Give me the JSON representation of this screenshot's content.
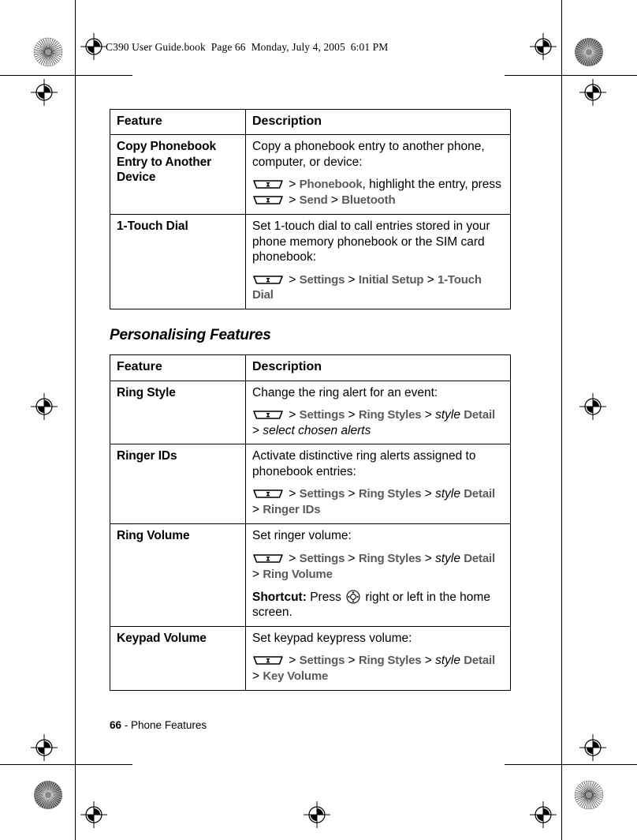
{
  "page": {
    "header_line": "C390 User Guide.book  Page 66  Monday, July 4, 2005  6:01 PM",
    "footer_page_number": "66",
    "footer_separator": " - ",
    "footer_section": "Phone Features"
  },
  "icons": {
    "softkey": "softkey-icon",
    "navkey": "navigation-key-icon"
  },
  "colors": {
    "menu_text": "#5a5a5a",
    "body_text": "#000000",
    "table_border": "#000000",
    "page_background": "#ffffff"
  },
  "table1": {
    "headers": {
      "feature": "Feature",
      "description": "Description"
    },
    "rows": [
      {
        "feature": "Copy Phonebook Entry to Another Device",
        "desc_intro": "Copy a phonebook entry to another phone, computer, or device:",
        "path_line1_menu1": "Phonebook",
        "path_line1_tail": ", highlight the entry, press",
        "path_line2_menu1": "Send",
        "path_line2_menu2": "Bluetooth"
      },
      {
        "feature": "1-Touch Dial",
        "desc_intro": "Set 1-touch dial to call entries stored in your phone memory phonebook or the SIM card phonebook:",
        "path_menu1": "Settings",
        "path_menu2": "Initial Setup",
        "path_menu3": "1-Touch Dial"
      }
    ]
  },
  "section_heading": "Personalising Features",
  "table2": {
    "headers": {
      "feature": "Feature",
      "description": "Description"
    },
    "rows": [
      {
        "feature": "Ring Style",
        "desc_intro": "Change the ring alert for an event:",
        "path_menu1": "Settings",
        "path_menu2": "Ring Styles",
        "path_italic": "style",
        "path_menu3": "Detail",
        "path_tail_italic": "select chosen alerts"
      },
      {
        "feature": "Ringer IDs",
        "desc_intro": "Activate distinctive ring alerts assigned to phonebook entries:",
        "path_menu1": "Settings",
        "path_menu2": "Ring Styles",
        "path_italic": "style",
        "path_menu3": "Detail",
        "path_menu4": "Ringer IDs"
      },
      {
        "feature": "Ring Volume",
        "desc_intro": "Set ringer volume:",
        "path_menu1": "Settings",
        "path_menu2": "Ring Styles",
        "path_italic": "style",
        "path_menu3": "Detail",
        "path_menu4": "Ring Volume",
        "shortcut_label": "Shortcut:",
        "shortcut_text_before": " Press ",
        "shortcut_text_after": " right or left in the home screen."
      },
      {
        "feature": "Keypad Volume",
        "desc_intro": "Set keypad keypress volume:",
        "path_menu1": "Settings",
        "path_menu2": "Ring Styles",
        "path_italic": "style",
        "path_menu3": "Detail",
        "path_menu4": "Key Volume"
      }
    ]
  }
}
